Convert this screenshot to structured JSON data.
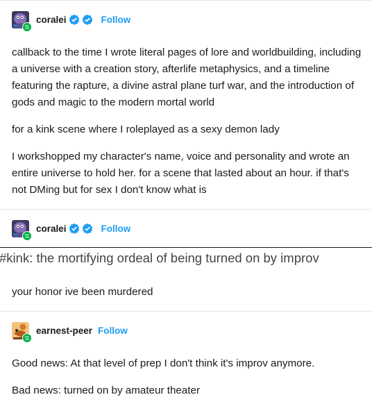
{
  "posts": [
    {
      "username": "coralei",
      "follow_label": "Follow",
      "paragraphs": [
        "callback to the time I wrote literal pages of lore and worldbuilding, including a universe with a creation story, afterlife metaphysics, and a timeline featuring the rapture, a divine astral plane turf war, and the introduction of gods and magic to the modern mortal world",
        "for a kink scene where I roleplayed as a sexy demon lady",
        "I workshopped my character's name, voice and personality and wrote an entire universe to hold her. for a scene that lasted about an hour. if that's not DMing but for sex I don't know what is"
      ]
    },
    {
      "username": "coralei",
      "follow_label": "Follow",
      "tag_line": "#kink: the mortifying ordeal of being turned on by improv",
      "paragraphs": [
        "your honor ive been murdered"
      ]
    },
    {
      "username": "earnest-peer",
      "follow_label": "Follow",
      "paragraphs": [
        "Good news: At that level of prep I don't think it's improv anymore.",
        "Bad news: turned on by amateur theater"
      ]
    }
  ],
  "colors": {
    "follow": "#1f9df2",
    "verified": "#1f9df2",
    "reblog_badge": "#00b34a",
    "text": "#1a1a1a",
    "divider": "#e6e6e6"
  },
  "icons": {
    "avatar_1": "purple-creature-avatar",
    "avatar_2": "orange-figure-avatar",
    "badge": "reblog-icon",
    "verified": "verified-badge-icon"
  }
}
